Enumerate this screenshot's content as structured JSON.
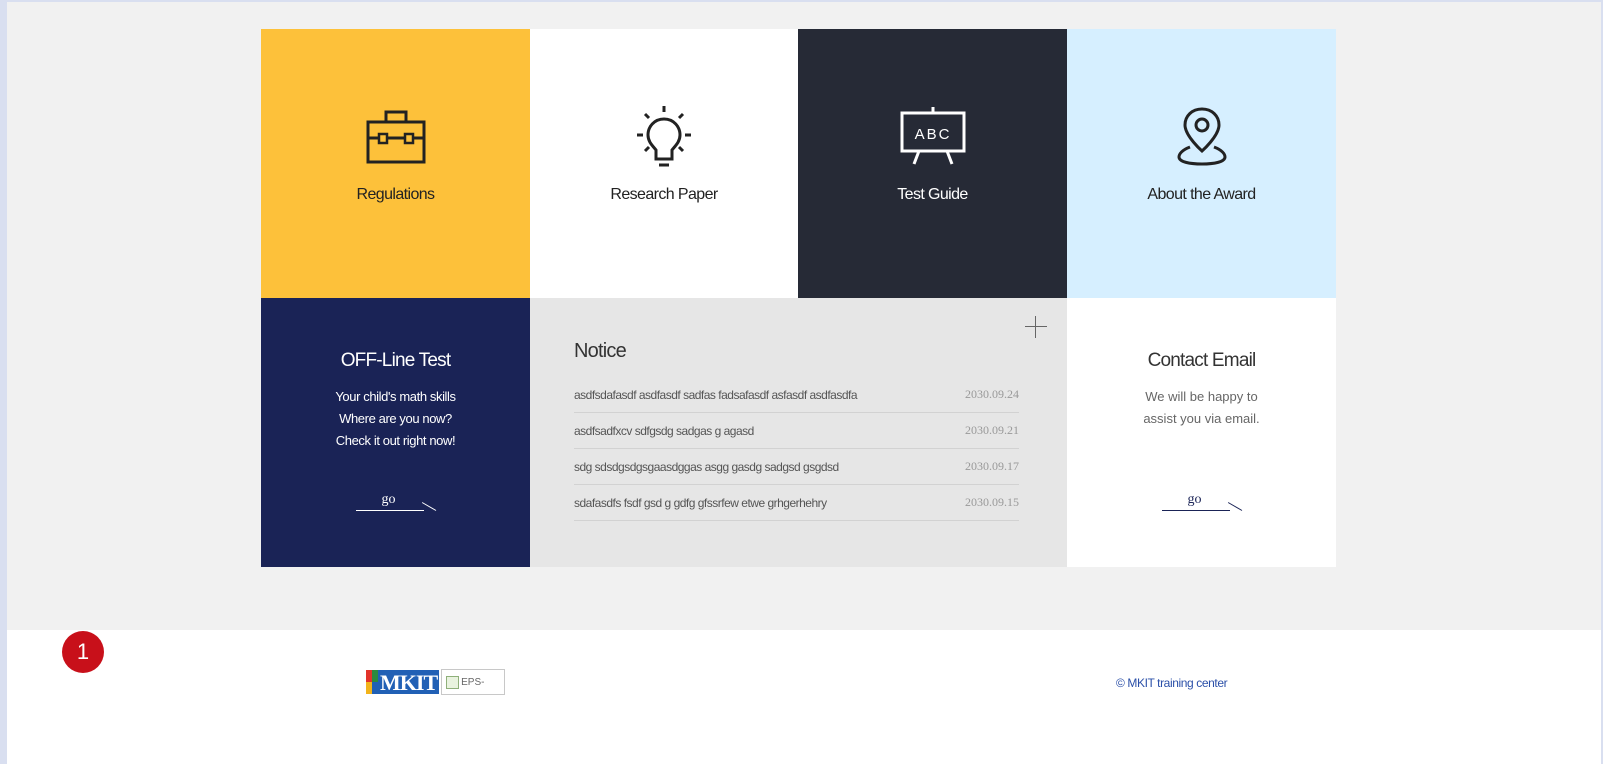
{
  "tiles": {
    "regulations": {
      "label": "Regulations",
      "icon": "briefcase-icon"
    },
    "research": {
      "label": "Research Paper",
      "icon": "lightbulb-icon"
    },
    "test_guide": {
      "label": "Test Guide",
      "icon": "abc-board-icon",
      "icon_text": "ABC"
    },
    "award": {
      "label": "About the Award",
      "icon": "location-pin-icon"
    }
  },
  "offline": {
    "title": "OFF-Line Test",
    "line1": "Your child's math skills",
    "line2": "Where are you now?",
    "line3": "Check it out right now!",
    "go": "go"
  },
  "notice": {
    "title": "Notice",
    "items": [
      {
        "text": "asdfsdafasdf asdfasdf sadfas fadsafasdf asfasdf asdfasdfa",
        "date": "2030.09.24"
      },
      {
        "text": "asdfsadfxcv sdfgsdg sadgas g agasd",
        "date": "2030.09.21"
      },
      {
        "text": "sdg sdsdgsdgsgaasdggas asgg  gasdg sadgsd  gsgdsd",
        "date": "2030.09.17"
      },
      {
        "text": "sdafasdfs fsdf gsd g gdfg gfssrfew etwe grhgerhehry",
        "date": "2030.09.15"
      }
    ]
  },
  "contact": {
    "title": "Contact Email",
    "line1": "We will be happy to",
    "line2": "assist you via email.",
    "go": "go"
  },
  "footer": {
    "badge": "1",
    "logo_text": "MKIT",
    "logo_broken_alt": "EPS-",
    "copyright": "© MKIT training center"
  },
  "colors": {
    "regulations_bg": "#fdc13a",
    "research_bg": "#ffffff",
    "test_guide_bg": "#262a36",
    "award_bg": "#d6efff",
    "offline_bg": "#1a2356",
    "notice_bg": "#e6e6e6",
    "badge": "#c8101a"
  }
}
